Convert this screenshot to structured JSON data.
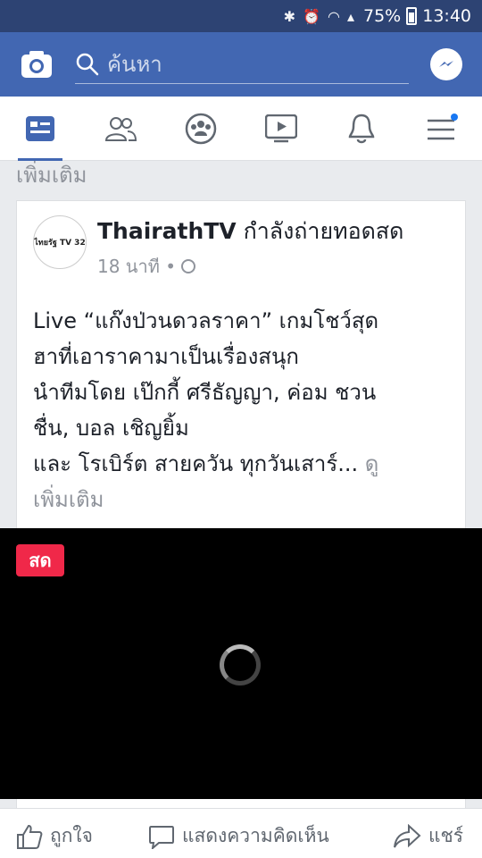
{
  "status_bar": {
    "icons": [
      "bluetooth-icon",
      "alarm-icon",
      "wifi-icon",
      "signal-icon"
    ],
    "battery": "75%",
    "time": "13:40"
  },
  "top_bar": {
    "search_placeholder": "ค้นหา",
    "accent": "#4267b2"
  },
  "nav": {
    "items": [
      {
        "icon": "news-feed-icon",
        "active": true
      },
      {
        "icon": "friends-icon",
        "active": false
      },
      {
        "icon": "groups-icon",
        "active": false
      },
      {
        "icon": "watch-icon",
        "active": false
      },
      {
        "icon": "notifications-icon",
        "active": false
      },
      {
        "icon": "menu-icon",
        "active": false,
        "badge": true
      }
    ]
  },
  "feed": {
    "see_more_top": "เพิ่มเติม",
    "post": {
      "page_name": "ThairathTV",
      "title_suffix": " กำลังถ่ายทอดสด",
      "time": "18 นาที •",
      "privacy_icon": "globe-icon",
      "avatar_text": "ไทยรัฐ TV 32",
      "body_lines": [
        "Live “แก๊งป่วนดวลราคา” เกมโชว์สุด",
        "ฮาที่เอาราคามาเป็นเรื่องสนุก",
        "นำทีมโดย เป๊กกี้ ศรีธัญญา, ค่อม ชวน",
        "ชื่น, บอล เชิญยิ้ม",
        "และ โรเบิร์ต สายควัน ทุกวันเสาร์..."
      ],
      "see_more_a": "ดู",
      "see_more_b": "เพิ่มเติม"
    },
    "video": {
      "live_label": "สด"
    }
  },
  "actions": {
    "like": "ถูกใจ",
    "comment": "แสดงความคิดเห็น",
    "share": "แชร์"
  }
}
